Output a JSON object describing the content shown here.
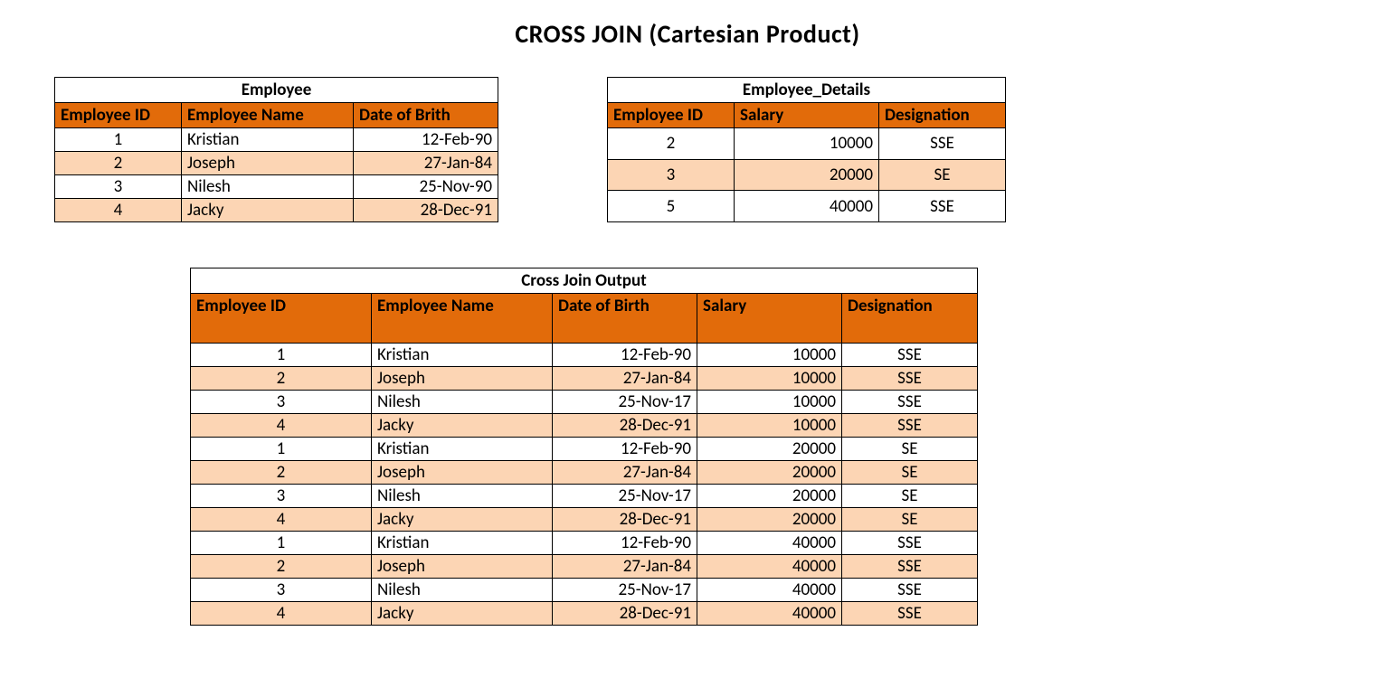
{
  "title": "CROSS JOIN (Cartesian Product)",
  "employee": {
    "caption": "Employee",
    "headers": [
      "Employee ID",
      "Employee Name",
      "Date of Brith"
    ],
    "rows": [
      {
        "id": "1",
        "name": "Kristian",
        "dob": "12-Feb-90"
      },
      {
        "id": "2",
        "name": "Joseph",
        "dob": "27-Jan-84"
      },
      {
        "id": "3",
        "name": "Nilesh",
        "dob": "25-Nov-90"
      },
      {
        "id": "4",
        "name": "Jacky",
        "dob": "28-Dec-91"
      }
    ]
  },
  "details": {
    "caption": "Employee_Details",
    "headers": [
      "Employee ID",
      "Salary",
      "Designation"
    ],
    "rows": [
      {
        "id": "2",
        "salary": "10000",
        "desig": "SSE"
      },
      {
        "id": "3",
        "salary": "20000",
        "desig": "SE"
      },
      {
        "id": "5",
        "salary": "40000",
        "desig": "SSE"
      }
    ]
  },
  "output": {
    "caption": "Cross Join Output",
    "headers": [
      "Employee ID",
      "Employee Name",
      "Date of Birth",
      "Salary",
      "Designation"
    ],
    "rows": [
      {
        "id": "1",
        "name": "Kristian",
        "dob": "12-Feb-90",
        "salary": "10000",
        "desig": "SSE"
      },
      {
        "id": "2",
        "name": "Joseph",
        "dob": "27-Jan-84",
        "salary": "10000",
        "desig": "SSE"
      },
      {
        "id": "3",
        "name": "Nilesh",
        "dob": "25-Nov-17",
        "salary": "10000",
        "desig": "SSE"
      },
      {
        "id": "4",
        "name": "Jacky",
        "dob": "28-Dec-91",
        "salary": "10000",
        "desig": "SSE"
      },
      {
        "id": "1",
        "name": "Kristian",
        "dob": "12-Feb-90",
        "salary": "20000",
        "desig": "SE"
      },
      {
        "id": "2",
        "name": "Joseph",
        "dob": "27-Jan-84",
        "salary": "20000",
        "desig": "SE"
      },
      {
        "id": "3",
        "name": "Nilesh",
        "dob": "25-Nov-17",
        "salary": "20000",
        "desig": "SE"
      },
      {
        "id": "4",
        "name": "Jacky",
        "dob": "28-Dec-91",
        "salary": "20000",
        "desig": "SE"
      },
      {
        "id": "1",
        "name": "Kristian",
        "dob": "12-Feb-90",
        "salary": "40000",
        "desig": "SSE"
      },
      {
        "id": "2",
        "name": "Joseph",
        "dob": "27-Jan-84",
        "salary": "40000",
        "desig": "SSE"
      },
      {
        "id": "3",
        "name": "Nilesh",
        "dob": "25-Nov-17",
        "salary": "40000",
        "desig": "SSE"
      },
      {
        "id": "4",
        "name": "Jacky",
        "dob": "28-Dec-91",
        "salary": "40000",
        "desig": "SSE"
      }
    ]
  }
}
